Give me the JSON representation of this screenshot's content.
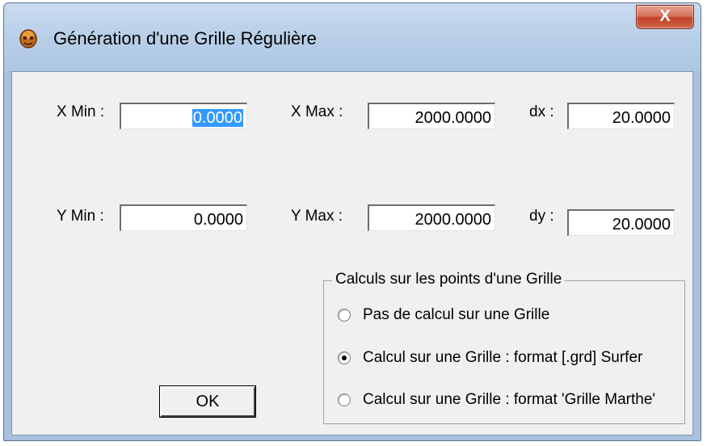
{
  "window": {
    "title": "Génération d'une Grille Régulière",
    "close_label": "X"
  },
  "fields": {
    "xmin": {
      "label": "X Min :",
      "value": "0.0000"
    },
    "xmax": {
      "label": "X Max :",
      "value": "2000.0000"
    },
    "dx": {
      "label": "dx :",
      "value": "20.0000"
    },
    "ymin": {
      "label": "Y Min :",
      "value": "0.0000"
    },
    "ymax": {
      "label": "Y Max :",
      "value": "2000.0000"
    },
    "dy": {
      "label": "dy :",
      "value": "20.0000"
    }
  },
  "grid_group": {
    "title": "Calculs sur les points d'une Grille",
    "options": [
      {
        "label": "Pas de calcul sur une Grille",
        "checked": false
      },
      {
        "label": "Calcul sur une Grille : format [.grd] Surfer",
        "checked": true
      },
      {
        "label": "Calcul sur une Grille : format 'Grille Marthe'",
        "checked": false
      }
    ]
  },
  "buttons": {
    "ok": "OK"
  }
}
